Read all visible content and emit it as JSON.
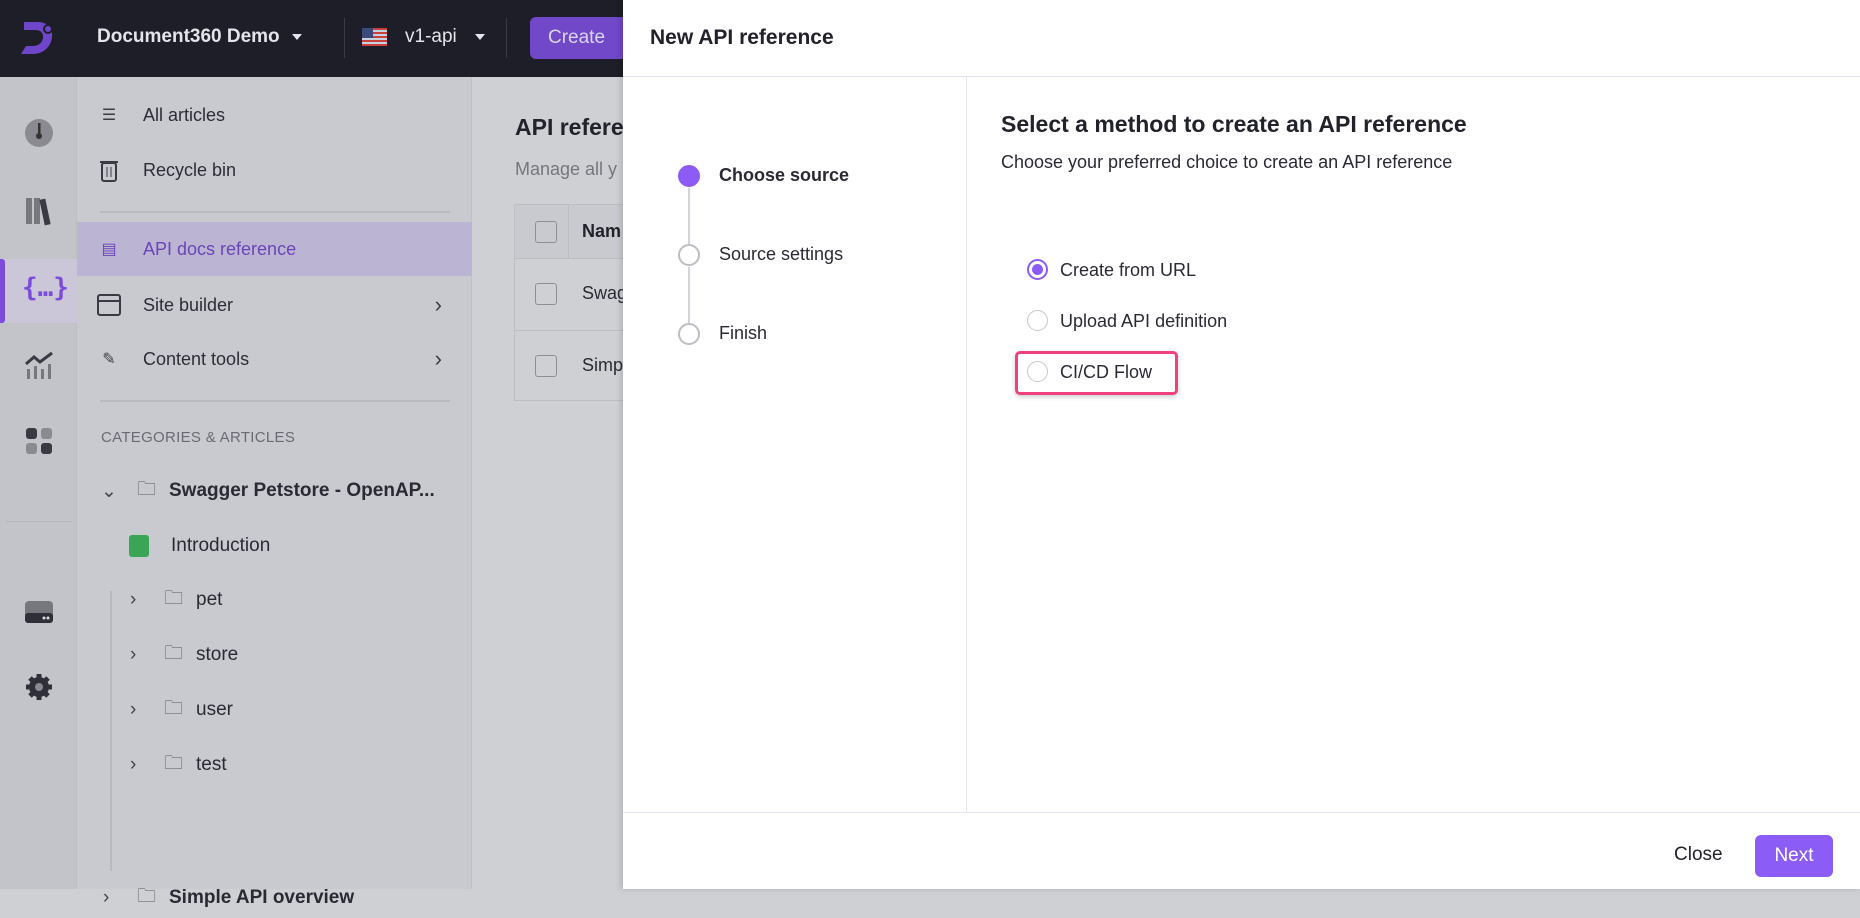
{
  "topbar": {
    "project": "Document360 Demo",
    "version": "v1-api",
    "create_label": "Create",
    "flag": "us-flag-icon"
  },
  "rail": {
    "icons": [
      "dashboard-icon",
      "documentation-icon",
      "api-docs-icon",
      "analytics-icon",
      "apps-icon",
      "drive-icon",
      "settings-icon"
    ],
    "accent": "#7c4ddc"
  },
  "nav": {
    "items": [
      {
        "label": "All articles"
      },
      {
        "label": "Recycle bin"
      },
      {
        "label": "API docs reference"
      },
      {
        "label": "Site builder"
      },
      {
        "label": "Content tools"
      }
    ],
    "section_title": "CATEGORIES & ARTICLES",
    "tree": {
      "root1": "Swagger Petstore - OpenAP...",
      "intro": "Introduction",
      "folders": [
        "pet",
        "store",
        "user",
        "test"
      ],
      "root2": "Simple API overview"
    }
  },
  "main": {
    "title": "API refere",
    "subtitle": "Manage all y",
    "header_col": "Nam",
    "rows": [
      "Swag",
      "Simp"
    ]
  },
  "modal": {
    "title": "New API reference",
    "steps": [
      {
        "label": "Choose source"
      },
      {
        "label": "Source settings"
      },
      {
        "label": "Finish"
      }
    ],
    "heading": "Select a method to create an API reference",
    "description": "Choose your preferred choice to create an API reference",
    "options": [
      {
        "label": "Create from URL",
        "selected": true
      },
      {
        "label": "Upload API definition"
      },
      {
        "label": "CI/CD Flow"
      }
    ],
    "close_label": "Close",
    "next_label": "Next",
    "accent": "#8b5cf6",
    "highlight": "#f0407f"
  }
}
